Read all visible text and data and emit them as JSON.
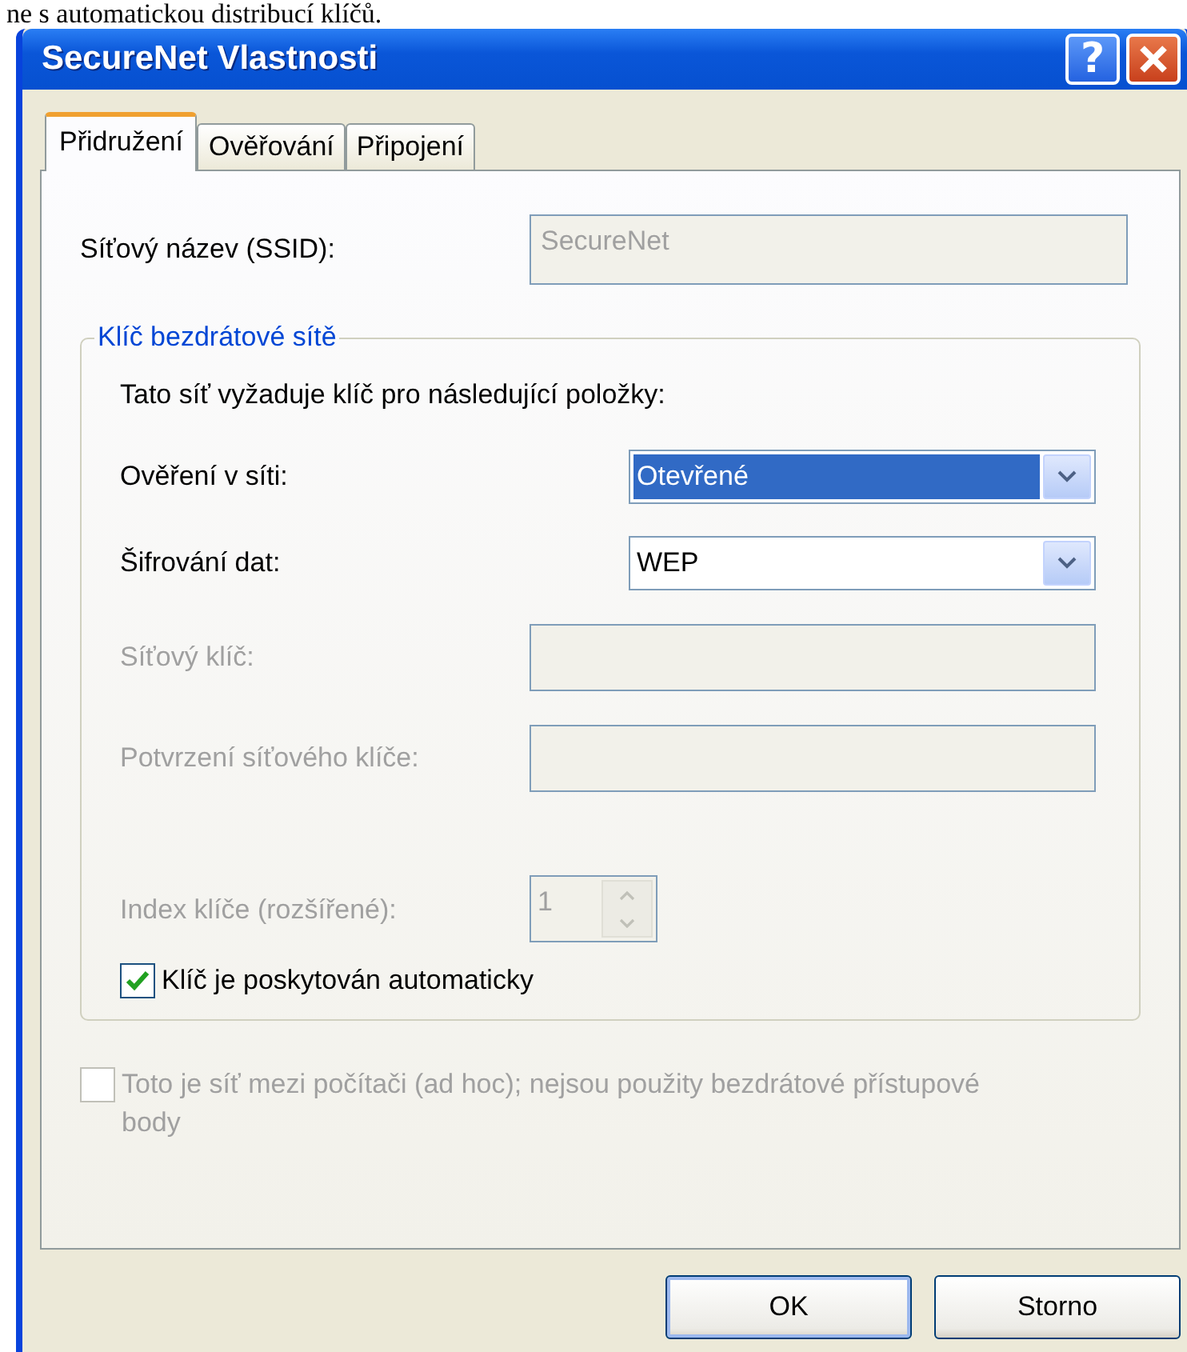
{
  "caption": "ne s automatickou distribucí klíčů.",
  "window": {
    "title": "SecureNet Vlastnosti",
    "help_button": "?"
  },
  "tabs": [
    {
      "label": "Přidružení",
      "selected": true
    },
    {
      "label": "Ověřování",
      "selected": false
    },
    {
      "label": "Připojení",
      "selected": false
    }
  ],
  "ssid": {
    "label": "Síťový název (SSID):",
    "value": "SecureNet",
    "disabled": true
  },
  "wireless_key": {
    "legend": "Klíč bezdrátové sítě",
    "intro": "Tato síť vyžaduje klíč pro následující položky:",
    "rows": [
      {
        "kind": "select",
        "label": "Ověření v síti:",
        "value": "Otevřené",
        "focused": true,
        "disabled": false
      },
      {
        "kind": "select",
        "label": "Šifrování dat:",
        "value": "WEP",
        "focused": false,
        "disabled": false
      },
      {
        "kind": "text",
        "label": "Síťový klíč:",
        "disabled": true
      },
      {
        "kind": "text",
        "label": "Potvrzení síťového klíče:",
        "disabled": true
      },
      {
        "kind": "spin",
        "label": "Index klíče (rozšířené):",
        "value": "1",
        "disabled": true
      }
    ],
    "auto_key": {
      "label": "Klíč je poskytován automaticky",
      "checked": true,
      "disabled": false
    }
  },
  "adhoc": {
    "label": "Toto je síť mezi počítači (ad hoc); nejsou použity bezdrátové přístupové body",
    "checked": false,
    "disabled": true
  },
  "buttons": [
    {
      "label": "OK",
      "default": true
    },
    {
      "label": "Storno",
      "default": false
    }
  ]
}
